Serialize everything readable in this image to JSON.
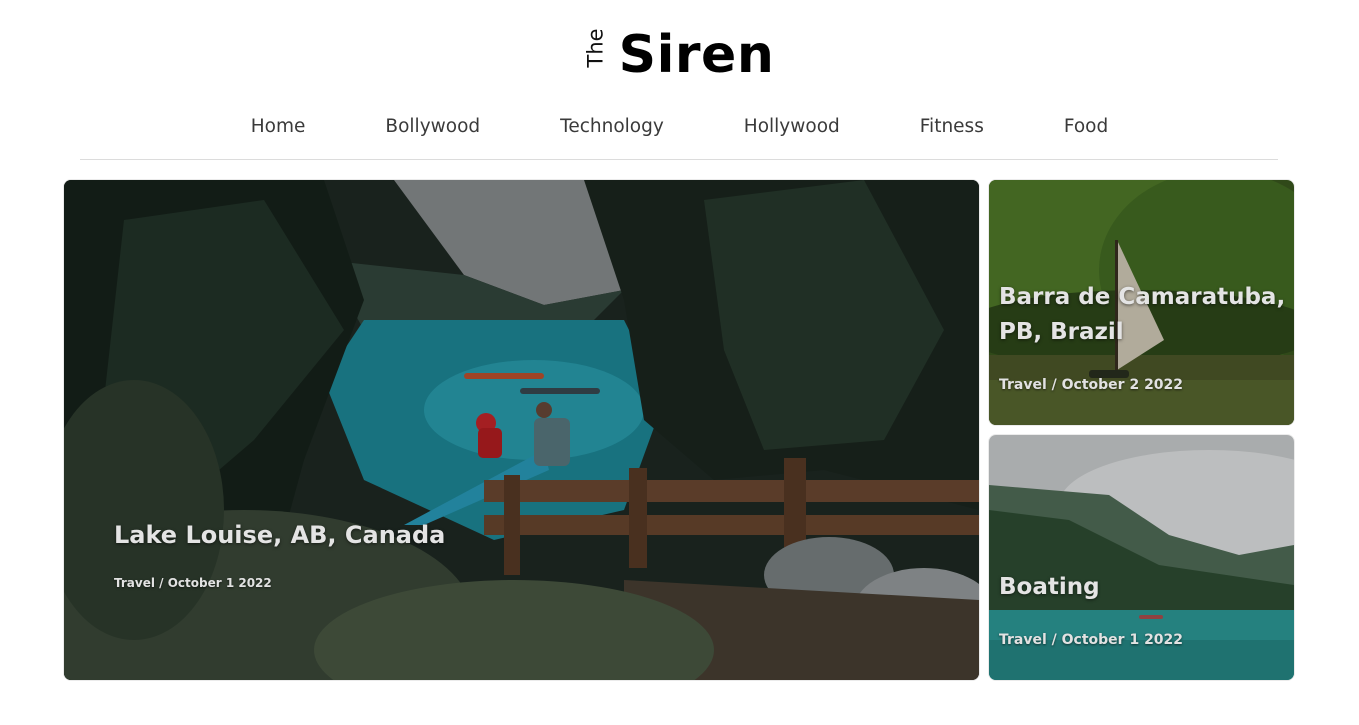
{
  "brand": {
    "the": "The",
    "name": "Siren"
  },
  "nav": {
    "items": [
      "Home",
      "Bollywood",
      "Technology",
      "Hollywood",
      "Fitness",
      "Food"
    ]
  },
  "featured": {
    "title": "Lake Louise, AB, Canada",
    "meta": "Travel / October 1 2022"
  },
  "side_posts": [
    {
      "title": "Barra de Camaratuba, PB, Brazil",
      "meta": "Travel / October 2 2022"
    },
    {
      "title": "Boating",
      "meta": "Travel / October 1 2022"
    }
  ]
}
